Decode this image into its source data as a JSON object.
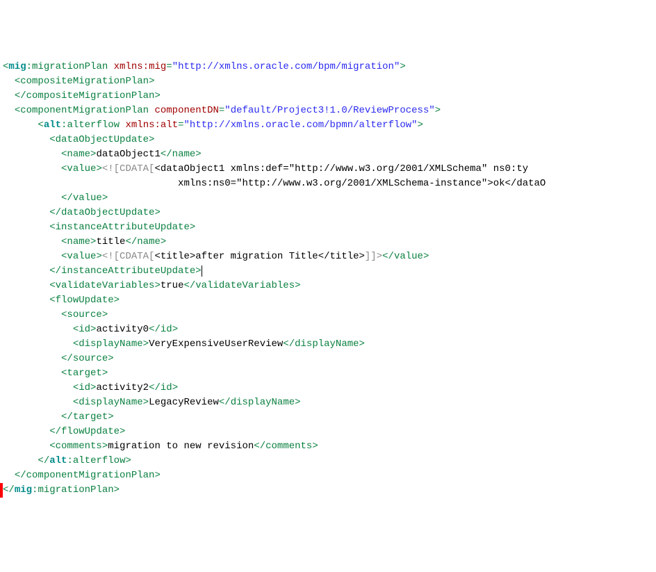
{
  "xml": {
    "rootPrefix": "mig",
    "rootName": "migrationPlan",
    "xmlnsMigAttr": "xmlns:mig",
    "xmlnsMigVal": "\"http://xmlns.oracle.com/bpm/migration\"",
    "compositeMigrationPlan": "compositeMigrationPlan",
    "componentMigrationPlan": "componentMigrationPlan",
    "componentDNAttr": "componentDN",
    "componentDNVal": "\"default/Project3!1.0/ReviewProcess\"",
    "altPrefix": "alt",
    "alterflow": "alterflow",
    "xmlnsAltAttr": "xmlns:alt",
    "xmlnsAltVal": "\"http://xmlns.oracle.com/bpmn/alterflow\"",
    "dataObjectUpdate": "dataObjectUpdate",
    "name": "name",
    "dataObject1Name": "dataObject1",
    "value": "value",
    "cdataOpen": "<![CDATA[",
    "cdataClose": "]]>",
    "dataObject1Open": "<dataObject1 xmlns:def=\"http://www.w3.org/2001/XMLSchema\" ns0:ty",
    "dataObject1Line2": "xmlns:ns0=\"http://www.w3.org/2001/XMLSchema-instance\">ok</dataO",
    "instanceAttributeUpdate": "instanceAttributeUpdate",
    "titleName": "title",
    "titleInner": "<title>after migration Title</title>",
    "validateVariables": "validateVariables",
    "validateVariablesVal": "true",
    "flowUpdate": "flowUpdate",
    "source": "source",
    "target": "target",
    "id": "id",
    "displayName": "displayName",
    "activity0": "activity0",
    "sourceDisplayName": "VeryExpensiveUserReview",
    "activity2": "activity2",
    "targetDisplayName": "LegacyReview",
    "comments": "comments",
    "commentsVal": "migration to new revision"
  }
}
